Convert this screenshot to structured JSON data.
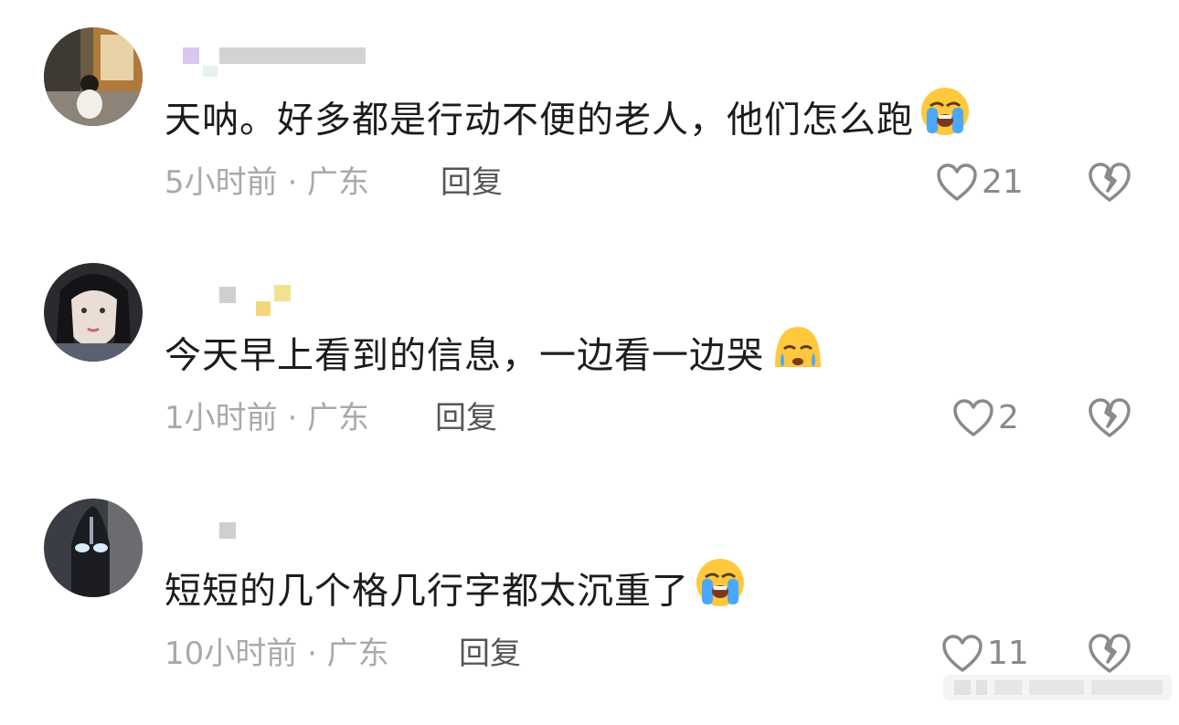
{
  "comments": [
    {
      "text": "天呐。好多都是行动不便的老人，他们怎么跑",
      "emoji": "loudly-crying-face",
      "time": "5小时前 · 广东",
      "reply_label": "回复",
      "likes": "21"
    },
    {
      "text": "今天早上看到的信息，一边看一边哭",
      "emoji": "crying-face",
      "time": "1小时前 · 广东",
      "reply_label": "回复",
      "likes": "2"
    },
    {
      "text": "短短的几个格几行字都太沉重了",
      "emoji": "loudly-crying-face",
      "time": "10小时前 · 广东",
      "reply_label": "回复",
      "likes": "11"
    }
  ],
  "icons": {
    "like": "heart-outline-icon",
    "dislike": "broken-heart-icon"
  },
  "colors": {
    "text": "#1c1c1c",
    "meta": "#a9a9a9",
    "icon": "#8a8a8a",
    "emoji_face": "#ffc83d",
    "emoji_tear": "#4aa8ff"
  }
}
